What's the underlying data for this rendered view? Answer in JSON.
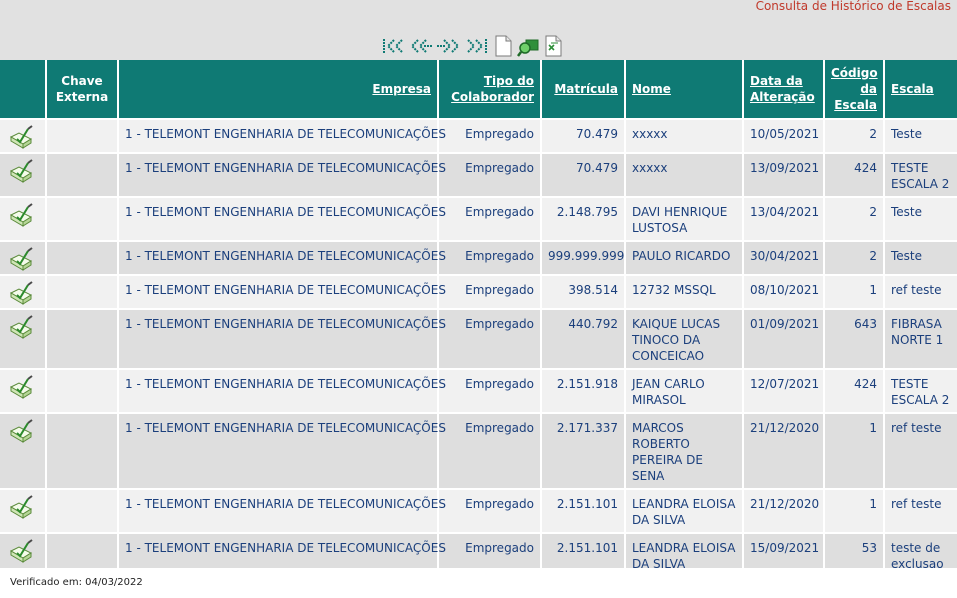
{
  "page_title": "Consulta de Histórico de Escalas",
  "toolbar": {
    "buttons": [
      {
        "icon": "first-page-icon"
      },
      {
        "icon": "previous-page-icon"
      },
      {
        "icon": "next-page-icon"
      },
      {
        "icon": "last-page-icon"
      },
      {
        "icon": "new-document-icon"
      },
      {
        "icon": "search-filter-icon"
      },
      {
        "icon": "export-excel-icon"
      }
    ]
  },
  "colors": {
    "header_bg": "#0f7a74",
    "row_odd": "#f1f1f1",
    "row_even": "#dedede",
    "title_red": "#c0392b",
    "link_blue": "#1b3f7c"
  },
  "table": {
    "headers": {
      "chave_line1": "Chave",
      "chave_line2": "Externa",
      "empresa": "Empresa",
      "tipo_line1": "Tipo do",
      "tipo_line2": "Colaborador",
      "matricula": "Matrícula",
      "nome": "Nome",
      "data_line1": "Data da",
      "data_line2": "Alteração",
      "codigo_line1": "Código",
      "codigo_line2": "da",
      "codigo_line3": "Escala",
      "escala": "Escala"
    },
    "rows": [
      {
        "chave": "",
        "empresa": "1 - TELEMONT ENGENHARIA DE TELECOMUNICAÇÕES",
        "tipo": "Empregado",
        "matricula": "70.479",
        "nome_line1": "xxxxx",
        "nome_line2": "",
        "nome_line3": "",
        "data": "10/05/2021",
        "codigo": "2",
        "escala_line1": "Teste",
        "escala_line2": ""
      },
      {
        "chave": "",
        "empresa": "1 - TELEMONT ENGENHARIA DE TELECOMUNICAÇÕES",
        "tipo": "Empregado",
        "matricula": "70.479",
        "nome_line1": "xxxxx",
        "nome_line2": "",
        "nome_line3": "",
        "data": "13/09/2021",
        "codigo": "424",
        "escala_line1": "TESTE",
        "escala_line2": "ESCALA 2"
      },
      {
        "chave": "",
        "empresa": "1 - TELEMONT ENGENHARIA DE TELECOMUNICAÇÕES",
        "tipo": "Empregado",
        "matricula": "2.148.795",
        "nome_line1": "DAVI HENRIQUE",
        "nome_line2": "LUSTOSA",
        "nome_line3": "",
        "data": "13/04/2021",
        "codigo": "2",
        "escala_line1": "Teste",
        "escala_line2": ""
      },
      {
        "chave": "",
        "empresa": "1 - TELEMONT ENGENHARIA DE TELECOMUNICAÇÕES",
        "tipo": "Empregado",
        "matricula": "999.999.999",
        "nome_line1": "PAULO RICARDO",
        "nome_line2": "",
        "nome_line3": "",
        "data": "30/04/2021",
        "codigo": "2",
        "escala_line1": "Teste",
        "escala_line2": ""
      },
      {
        "chave": "",
        "empresa": "1 - TELEMONT ENGENHARIA DE TELECOMUNICAÇÕES",
        "tipo": "Empregado",
        "matricula": "398.514",
        "nome_line1": "12732 MSSQL",
        "nome_line2": "",
        "nome_line3": "",
        "data": "08/10/2021",
        "codigo": "1",
        "escala_line1": "ref teste",
        "escala_line2": ""
      },
      {
        "chave": "",
        "empresa": "1 - TELEMONT ENGENHARIA DE TELECOMUNICAÇÕES",
        "tipo": "Empregado",
        "matricula": "440.792",
        "nome_line1": "KAIQUE LUCAS",
        "nome_line2": "TINOCO DA",
        "nome_line3": "CONCEICAO",
        "data": "01/09/2021",
        "codigo": "643",
        "escala_line1": "FIBRASA",
        "escala_line2": "NORTE 1"
      },
      {
        "chave": "",
        "empresa": "1 - TELEMONT ENGENHARIA DE TELECOMUNICAÇÕES",
        "tipo": "Empregado",
        "matricula": "2.151.918",
        "nome_line1": "JEAN CARLO",
        "nome_line2": "MIRASOL",
        "nome_line3": "",
        "data": "12/07/2021",
        "codigo": "424",
        "escala_line1": "TESTE",
        "escala_line2": "ESCALA 2"
      },
      {
        "chave": "",
        "empresa": "1 - TELEMONT ENGENHARIA DE TELECOMUNICAÇÕES",
        "tipo": "Empregado",
        "matricula": "2.171.337",
        "nome_line1": "MARCOS",
        "nome_line2": "ROBERTO",
        "nome_line3": "PEREIRA DE SENA",
        "data": "21/12/2020",
        "codigo": "1",
        "escala_line1": "ref teste",
        "escala_line2": ""
      },
      {
        "chave": "",
        "empresa": "1 - TELEMONT ENGENHARIA DE TELECOMUNICAÇÕES",
        "tipo": "Empregado",
        "matricula": "2.151.101",
        "nome_line1": "LEANDRA ELOISA",
        "nome_line2": "DA SILVA",
        "nome_line3": "",
        "data": "21/12/2020",
        "codigo": "1",
        "escala_line1": "ref teste",
        "escala_line2": ""
      },
      {
        "chave": "",
        "empresa": "1 - TELEMONT ENGENHARIA DE TELECOMUNICAÇÕES",
        "tipo": "Empregado",
        "matricula": "2.151.101",
        "nome_line1": "LEANDRA ELOISA",
        "nome_line2": "DA SILVA",
        "nome_line3": "",
        "data": "15/09/2021",
        "codigo": "53",
        "escala_line1": "teste de",
        "escala_line2": "exclusao"
      }
    ]
  },
  "footer": {
    "verified": "Verificado em: 04/03/2022"
  }
}
